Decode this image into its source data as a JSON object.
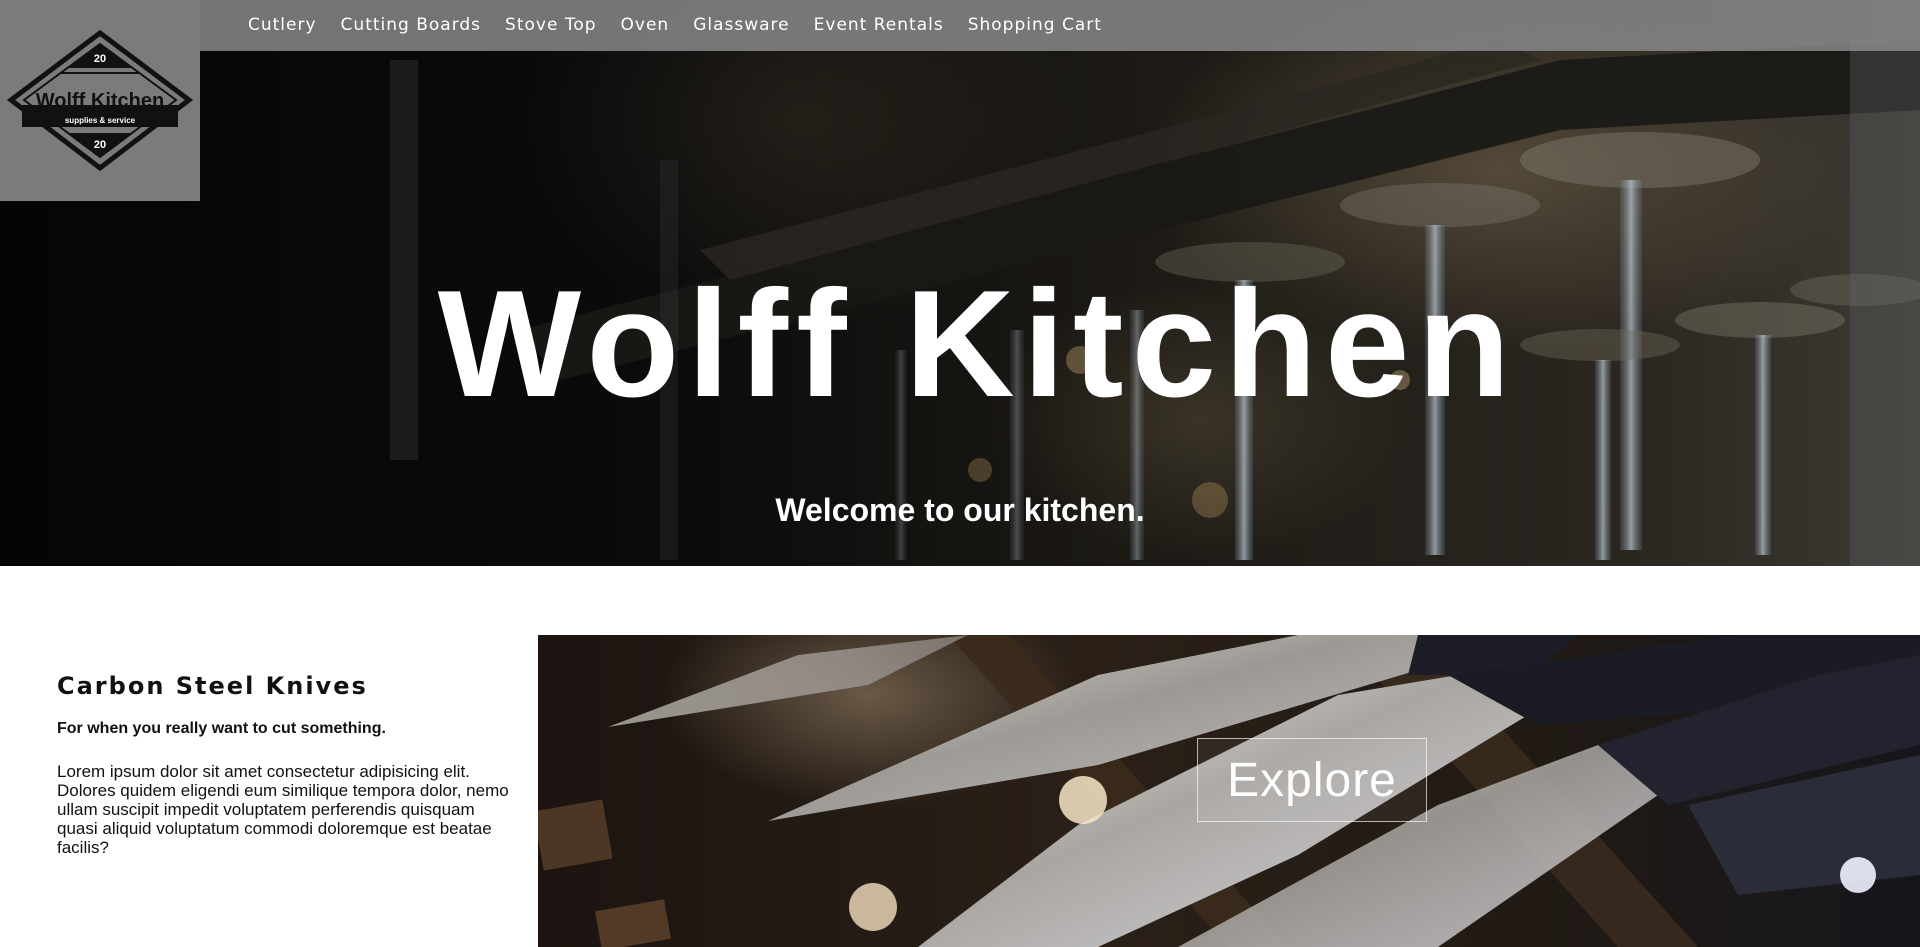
{
  "nav": {
    "items": [
      {
        "label": "Cutlery"
      },
      {
        "label": "Cutting Boards"
      },
      {
        "label": "Stove Top"
      },
      {
        "label": "Oven"
      },
      {
        "label": "Glassware"
      },
      {
        "label": "Event Rentals"
      },
      {
        "label": "Shopping Cart"
      }
    ]
  },
  "logo": {
    "top_number": "20",
    "name": "Wolff Kitchen",
    "tagline": "supplies & service",
    "bottom_number": "20"
  },
  "hero": {
    "title": "Wolff Kitchen",
    "subtitle": "Welcome to our kitchen."
  },
  "feature": {
    "heading": "Carbon Steel Knives",
    "tagline": "For when you really want to cut something.",
    "body": "Lorem ipsum dolor sit amet consectetur adipisicing elit. Dolores quidem eligendi eum similique tempora dolor, nemo ullam suscipit impedit voluptatem perferendis quisquam quasi aliquid voluptatum commodi doloremque est beatae facilis?",
    "button_label": "Explore"
  },
  "colors": {
    "nav_bar": "#8c8c8c",
    "logo_box": "#7b7b7a",
    "text_light": "#ffffff",
    "text_dark": "#111111"
  }
}
